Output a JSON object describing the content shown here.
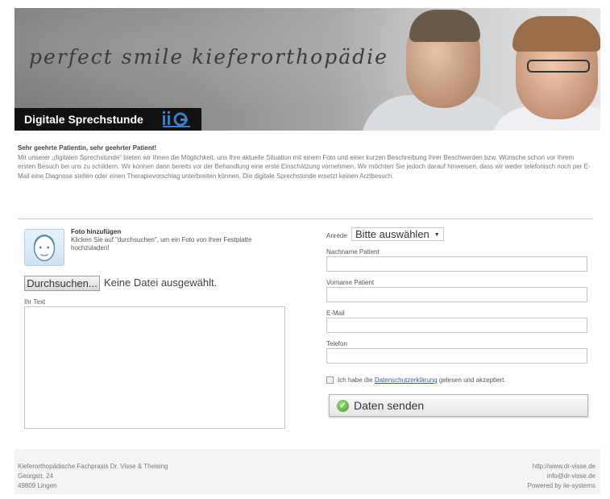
{
  "header": {
    "title": "perfect smile kieferorthopädie",
    "banner_label": "Digitale Sprechstunde",
    "logo_text": "ii systems"
  },
  "intro": {
    "title": "Sehr geehrte Patientin, sehr geehrter Patient!",
    "text": "Mit unserer „digitalen Sprechstunde“ bieten wir Ihnen die Möglichkeit, uns Ihre aktuelle Situation mit einem Foto und einer kurzen Beschreibung Ihrer Beschwerden bzw. Wünsche schon vor Ihrem ersten Besuch bei uns zu schildern. Wir können dann bereits vor der Behandlung eine erste Einschätzung vornehmen. Wir möchten Sie jedoch darauf hinweisen, dass wir weder telefonisch noch per E-Mail eine Diagnose stellen oder einen Therapievorschlag unterbreiten können. Die digitale Sprechstunde ersetzt keinen Arztbesuch."
  },
  "photo": {
    "title": "Foto hinzufügen",
    "text": "Klicken Sie auf \"durchsuchen\", um ein Foto von Ihrer Festplatte hochzuladen!",
    "browse_label": "Durchsuchen...",
    "no_file_label": "Keine Datei ausgewählt."
  },
  "message": {
    "label": "Ihr Text",
    "value": ""
  },
  "form": {
    "anrede_label": "Anrede",
    "anrede_value": "Bitte auswählen",
    "lastname_label": "Nachname Patient",
    "lastname_value": "",
    "firstname_label": "Vorname Patient",
    "firstname_value": "",
    "email_label": "E-Mail",
    "email_value": "",
    "phone_label": "Telefon",
    "phone_value": "",
    "consent_prefix": "Ich habe die ",
    "consent_link": "Datenschutzerklärung",
    "consent_suffix": " gelesen und akzeptiert.",
    "consent_checked": false,
    "submit_label": "Daten senden"
  },
  "footer": {
    "address_line1": "Kieferorthopädische Fachpraxis Dr. Visse & Theising",
    "address_line2": "Georgstr. 24",
    "address_line3": "49809 Lingen",
    "website": "http://www.dr-visse.de",
    "email": "info@dr-visse.de",
    "powered_by": "Powered by iie-systems"
  },
  "colors": {
    "banner_bg": "#111111",
    "link": "#2a5db0",
    "logo_accent": "#3b7fc4",
    "send_icon": "#3a9a2a"
  },
  "icons": {
    "avatar": "face-placeholder-icon",
    "send": "checkmark-icon",
    "dropdown": "caret-down-icon"
  }
}
